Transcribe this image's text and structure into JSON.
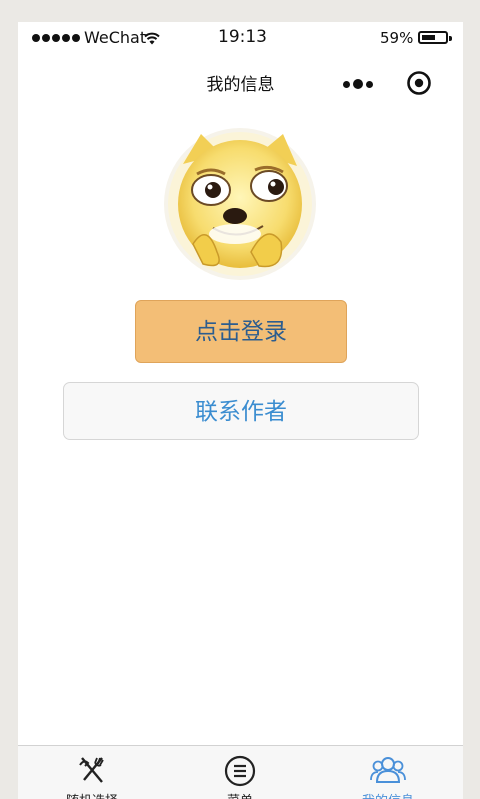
{
  "status_bar": {
    "carrier": "WeChat",
    "time": "19:13",
    "battery_percent": "59%",
    "battery_level": 0.59
  },
  "nav": {
    "title": "我的信息"
  },
  "profile": {
    "avatar_icon": "doge-emoji-avatar"
  },
  "buttons": {
    "login_label": "点击登录",
    "contact_label": "联系作者"
  },
  "tab_bar": {
    "items": [
      {
        "label": "随机选择",
        "icon": "fork-knife-icon"
      },
      {
        "label": "菜单",
        "icon": "menu-list-icon"
      },
      {
        "label": "我的信息",
        "icon": "users-icon",
        "active": true
      }
    ]
  },
  "colors": {
    "login_bg": "#f3be76",
    "accent_blue": "#4a90d9",
    "page_bg": "#ebe9e5"
  }
}
